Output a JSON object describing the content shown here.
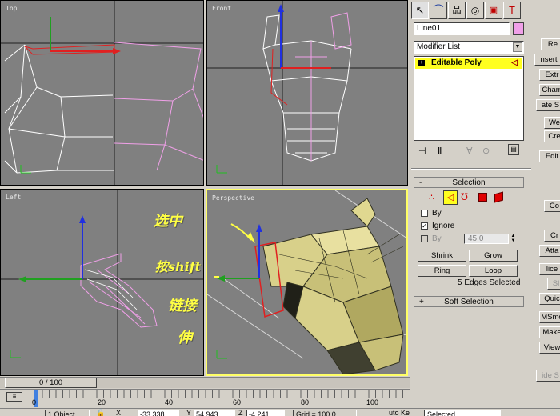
{
  "viewports": {
    "top": "Top",
    "front": "Front",
    "left": "Left",
    "perspective": "Perspective"
  },
  "annotations": [
    "选中",
    "按shift",
    "链接",
    "伸"
  ],
  "panel": {
    "object_name": "Line01",
    "modifier_list": "Modifier List",
    "stack_item": "Editable Poly",
    "selection_title": "Selection",
    "by_vertex": "By",
    "ignore_backfacing": "Ignore",
    "by_angle": "By",
    "angle_value": "45.0",
    "shrink": "Shrink",
    "grow": "Grow",
    "ring": "Ring",
    "loop": "Loop",
    "status": "5 Edges Selected",
    "soft_selection": "Soft Selection",
    "ignore_checked": "✓"
  },
  "right_strip": [
    "Re",
    "nsert",
    "Extr",
    "Cham",
    "ate S",
    "We",
    "Cre",
    "Edit",
    "Co",
    "Cr",
    "Atta",
    "lice",
    "Sl",
    "Quic",
    "MSmo",
    "Make",
    "View",
    "ide S"
  ],
  "timeline": {
    "frame": "0 / 100",
    "ticks": [
      "0",
      "20",
      "40",
      "60",
      "80",
      "100"
    ]
  },
  "statusbar": {
    "objects": "1 Object",
    "x": "-33.338",
    "y": "54.943",
    "z": "-4.241",
    "grid": "Grid = 100.0",
    "key": "uto Ke",
    "selected": "Selected"
  }
}
